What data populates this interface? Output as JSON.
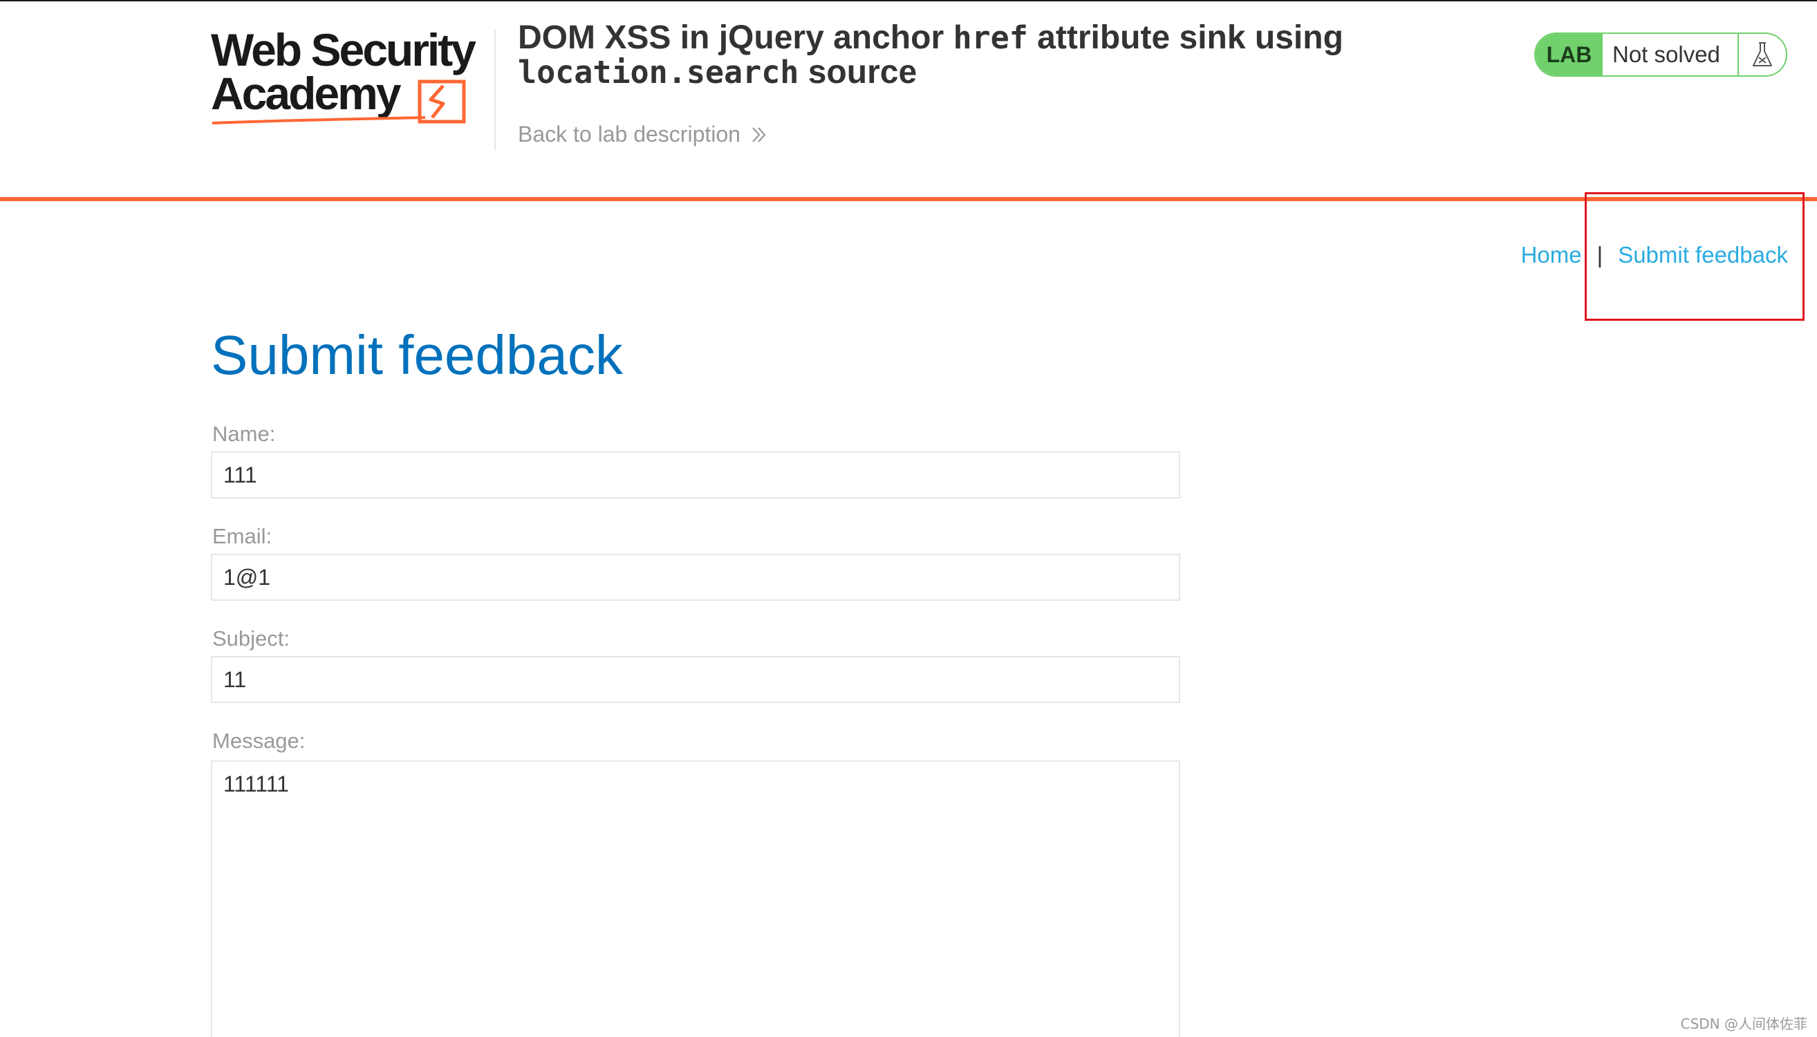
{
  "header": {
    "logo": {
      "line1": "Web Security",
      "line2": "Academy"
    },
    "lab_title_parts": {
      "part1": "DOM XSS in jQuery anchor ",
      "code1": "href",
      "part2": " attribute sink using",
      "code2": "location.search",
      "part3": " source"
    },
    "back_link": "Back to lab description",
    "lab_badge": {
      "tag": "LAB",
      "status": "Not solved"
    }
  },
  "nav": {
    "home": "Home",
    "separator": "|",
    "submit_feedback": "Submit feedback"
  },
  "page": {
    "heading": "Submit feedback",
    "fields": {
      "name": {
        "label": "Name:",
        "value": "111"
      },
      "email": {
        "label": "Email:",
        "value": "1@1"
      },
      "subject": {
        "label": "Subject:",
        "value": "11"
      },
      "message": {
        "label": "Message:",
        "value": "111111"
      }
    }
  },
  "watermark": "CSDN @人间体佐菲",
  "colors": {
    "accent_orange": "#ff6633",
    "heading_blue": "#0071bc",
    "link_blue": "#29abe0",
    "lab_green": "#70d16d",
    "highlight_red": "#e0151f"
  }
}
